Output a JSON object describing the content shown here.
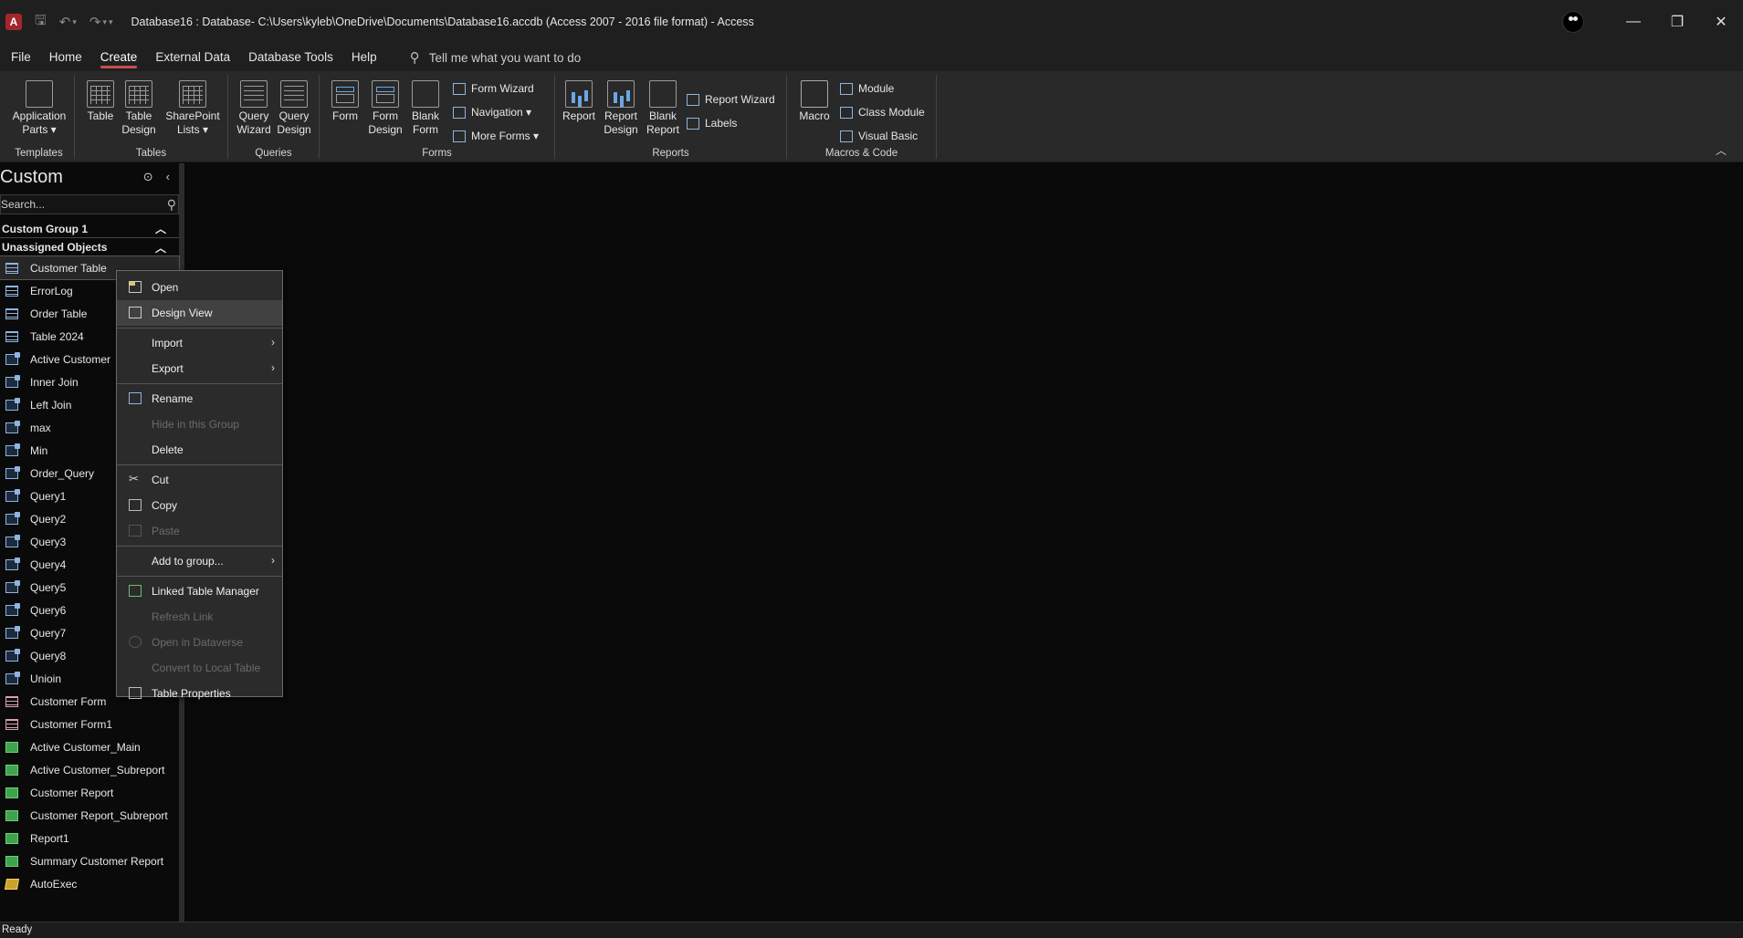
{
  "window": {
    "title": "Database16 : Database- C:\\Users\\kyleb\\OneDrive\\Documents\\Database16.accdb (Access 2007 - 2016 file format)  -  Access",
    "app_logo": "A"
  },
  "tabs": [
    {
      "label": "File"
    },
    {
      "label": "Home"
    },
    {
      "label": "Create",
      "active": true
    },
    {
      "label": "External Data"
    },
    {
      "label": "Database Tools"
    },
    {
      "label": "Help"
    }
  ],
  "tell_me": "Tell me what you want to do",
  "ribbon": {
    "templates": {
      "label": "Templates",
      "application_parts": "Application Parts"
    },
    "tables": {
      "label": "Tables",
      "table": "Table",
      "table_design": "Table Design",
      "sharepoint_lists": "SharePoint Lists"
    },
    "queries": {
      "label": "Queries",
      "query_wizard": "Query Wizard",
      "query_design": "Query Design"
    },
    "forms": {
      "label": "Forms",
      "form": "Form",
      "form_design": "Form Design",
      "blank_form": "Blank Form",
      "form_wizard": "Form Wizard",
      "navigation": "Navigation",
      "more_forms": "More Forms"
    },
    "reports": {
      "label": "Reports",
      "report": "Report",
      "report_design": "Report Design",
      "blank_report": "Blank Report",
      "report_wizard": "Report Wizard",
      "labels": "Labels"
    },
    "macros": {
      "label": "Macros & Code",
      "macro": "Macro",
      "module": "Module",
      "class_module": "Class Module",
      "visual_basic": "Visual Basic"
    }
  },
  "nav": {
    "title": "Custom",
    "search_placeholder": "Search...",
    "groups": {
      "custom_group_1": "Custom Group 1",
      "unassigned": "Unassigned Objects"
    },
    "items": [
      {
        "label": "Customer Table",
        "type": "table"
      },
      {
        "label": "ErrorLog",
        "type": "table"
      },
      {
        "label": "Order Table",
        "type": "table"
      },
      {
        "label": "Table 2024",
        "type": "table"
      },
      {
        "label": "Active Customer",
        "type": "query"
      },
      {
        "label": "Inner Join",
        "type": "query"
      },
      {
        "label": "Left Join",
        "type": "query"
      },
      {
        "label": "max",
        "type": "query"
      },
      {
        "label": "Min",
        "type": "query"
      },
      {
        "label": "Order_Query",
        "type": "query"
      },
      {
        "label": "Query1",
        "type": "query"
      },
      {
        "label": "Query2",
        "type": "query"
      },
      {
        "label": "Query3",
        "type": "query"
      },
      {
        "label": "Query4",
        "type": "query"
      },
      {
        "label": "Query5",
        "type": "query"
      },
      {
        "label": "Query6",
        "type": "query"
      },
      {
        "label": "Query7",
        "type": "query"
      },
      {
        "label": "Query8",
        "type": "query"
      },
      {
        "label": "Unioin",
        "type": "query"
      },
      {
        "label": "Customer Form",
        "type": "form"
      },
      {
        "label": "Customer Form1",
        "type": "form"
      },
      {
        "label": "Active Customer_Main",
        "type": "report"
      },
      {
        "label": "Active Customer_Subreport",
        "type": "report"
      },
      {
        "label": "Customer Report",
        "type": "report"
      },
      {
        "label": "Customer Report_Subreport",
        "type": "report"
      },
      {
        "label": "Report1",
        "type": "report"
      },
      {
        "label": "Summary Customer Report",
        "type": "report"
      },
      {
        "label": "AutoExec",
        "type": "macro"
      }
    ]
  },
  "context_menu": {
    "open": "Open",
    "design_view": "Design View",
    "import": "Import",
    "export": "Export",
    "rename": "Rename",
    "hide_in_group": "Hide in this Group",
    "delete": "Delete",
    "cut": "Cut",
    "copy": "Copy",
    "paste": "Paste",
    "add_to_group": "Add to group...",
    "linked_table_manager": "Linked Table Manager",
    "refresh_link": "Refresh Link",
    "open_in_dataverse": "Open in Dataverse",
    "convert_to_local": "Convert to Local Table",
    "table_properties": "Table Properties"
  },
  "status": "Ready"
}
